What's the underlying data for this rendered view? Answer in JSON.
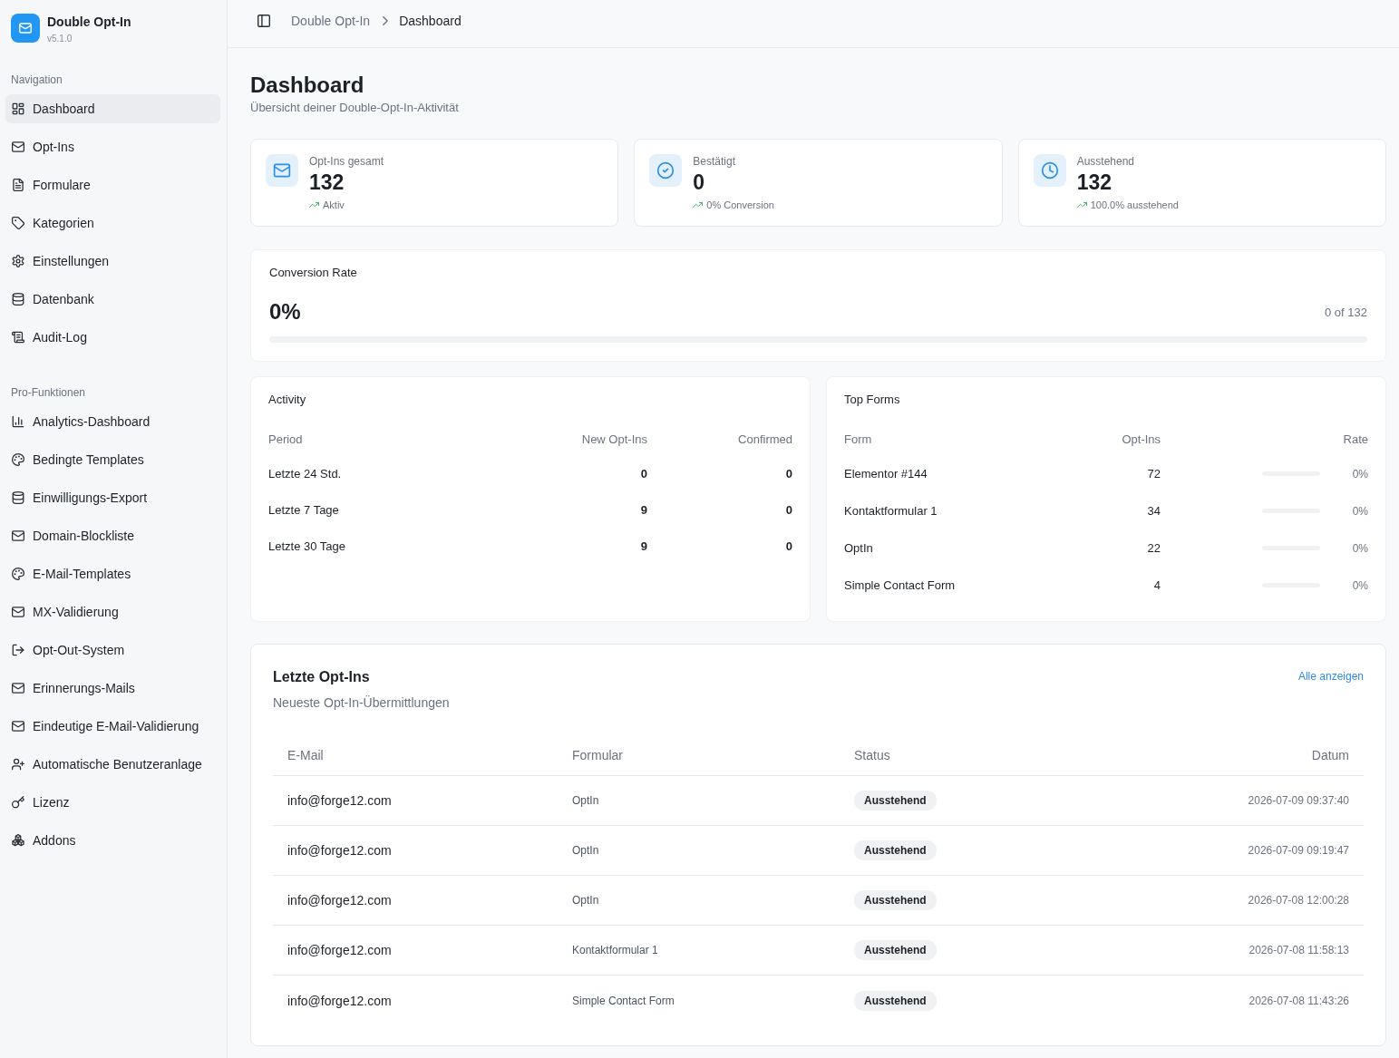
{
  "app": {
    "name": "Double Opt-In",
    "version": "v5.1.0"
  },
  "sidebar": {
    "sections": [
      {
        "label": "Navigation",
        "items": [
          {
            "label": "Dashboard",
            "selected": true
          },
          {
            "label": "Opt-Ins",
            "selected": false
          },
          {
            "label": "Formulare",
            "selected": false
          },
          {
            "label": "Kategorien",
            "selected": false
          },
          {
            "label": "Einstellungen",
            "selected": false
          },
          {
            "label": "Datenbank",
            "selected": false
          },
          {
            "label": "Audit-Log",
            "selected": false
          }
        ]
      },
      {
        "label": "Pro-Funktionen",
        "items": [
          {
            "label": "Analytics-Dashboard",
            "selected": false
          },
          {
            "label": "Bedingte Templates",
            "selected": false
          },
          {
            "label": "Einwilligungs-Export",
            "selected": false
          },
          {
            "label": "Domain-Blockliste",
            "selected": false
          },
          {
            "label": "E-Mail-Templates",
            "selected": false
          },
          {
            "label": "MX-Validierung",
            "selected": false
          },
          {
            "label": "Opt-Out-System",
            "selected": false
          },
          {
            "label": "Erinnerungs-Mails",
            "selected": false
          },
          {
            "label": "Eindeutige E-Mail-Validierung",
            "selected": false
          },
          {
            "label": "Automatische Benutzeranlage",
            "selected": false
          },
          {
            "label": "Lizenz",
            "selected": false
          },
          {
            "label": "Addons",
            "selected": false
          }
        ]
      }
    ]
  },
  "breadcrumb": [
    "Double Opt-In",
    "Dashboard"
  ],
  "page": {
    "title": "Dashboard",
    "subtitle": "Übersicht deiner Double-Opt-In-Aktivität"
  },
  "stats": [
    {
      "label": "Opt-Ins gesamt",
      "value": "132",
      "note": "Aktiv"
    },
    {
      "label": "Bestätigt",
      "value": "0",
      "note": "0% Conversion"
    },
    {
      "label": "Ausstehend",
      "value": "132",
      "note": "100.0% ausstehend"
    }
  ],
  "conversion": {
    "title": "Conversion Rate",
    "value": "0%",
    "count": "0 of 132",
    "level": 0
  },
  "activity": {
    "title": "Activity",
    "columns": [
      "Period",
      "New Opt-Ins",
      "Confirmed"
    ],
    "rows": [
      {
        "period": "Letzte 24 Std.",
        "new_opt_ins": "0",
        "confirmed": "0"
      },
      {
        "period": "Letzte 7 Tage",
        "new_opt_ins": "9",
        "confirmed": "0"
      },
      {
        "period": "Letzte 30 Tage",
        "new_opt_ins": "9",
        "confirmed": "0"
      }
    ]
  },
  "top_forms": {
    "title": "Top Forms",
    "columns": [
      "Form",
      "Opt-Ins",
      "Rate"
    ],
    "rows": [
      {
        "form": "Elementor #144",
        "opt_ins": "72",
        "level": 0,
        "rate": "0%"
      },
      {
        "form": "Kontaktformular 1",
        "opt_ins": "34",
        "level": 0,
        "rate": "0%"
      },
      {
        "form": "OptIn",
        "opt_ins": "22",
        "level": 0,
        "rate": "0%"
      },
      {
        "form": "Simple Contact Form",
        "opt_ins": "4",
        "level": 0,
        "rate": "0%"
      }
    ]
  },
  "recent": {
    "title": "Letzte Opt-Ins",
    "subtitle": "Neueste Opt-In-Übermittlungen",
    "link": "Alle anzeigen",
    "columns": [
      "E-Mail",
      "Formular",
      "Status",
      "Datum"
    ],
    "rows": [
      {
        "email": "info@forge12.com",
        "form": "OptIn",
        "status": "Ausstehend",
        "date": "2026-07-09 09:37:40"
      },
      {
        "email": "info@forge12.com",
        "form": "OptIn",
        "status": "Ausstehend",
        "date": "2026-07-09 09:19:47"
      },
      {
        "email": "info@forge12.com",
        "form": "OptIn",
        "status": "Ausstehend",
        "date": "2026-07-08 12:00:28"
      },
      {
        "email": "info@forge12.com",
        "form": "Kontaktformular 1",
        "status": "Ausstehend",
        "date": "2026-07-08 11:58:13"
      },
      {
        "email": "info@forge12.com",
        "form": "Simple Contact Form",
        "status": "Ausstehend",
        "date": "2026-07-08 11:43:26"
      }
    ]
  }
}
